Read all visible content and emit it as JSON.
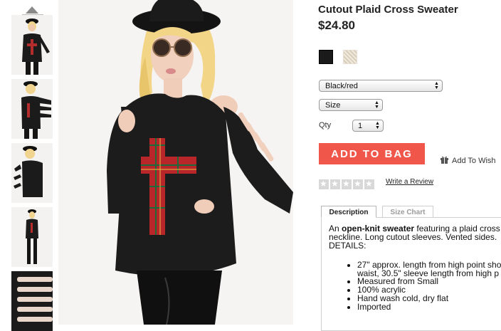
{
  "product": {
    "title": "Cutout Plaid Cross Sweater",
    "price": "$24.80"
  },
  "swatches": [
    {
      "name": "black",
      "color": "#1a1a1a"
    },
    {
      "name": "cream",
      "color": "#efe6d8"
    }
  ],
  "selects": {
    "color": {
      "value": "Black/red"
    },
    "size": {
      "value": "Size"
    },
    "qty_label": "Qty",
    "qty": {
      "value": "1"
    }
  },
  "actions": {
    "add_to_bag": "ADD TO BAG",
    "add_to_wishlist": "Add To Wish",
    "write_review": "Write a Review"
  },
  "rating": {
    "stars": 0,
    "max": 5
  },
  "tabs": [
    {
      "label": "Description",
      "active": true
    },
    {
      "label": "Size Chart",
      "active": false
    }
  ],
  "description": {
    "intro_prefix": "An ",
    "intro_bold": "open-knit sweater",
    "intro_rest": " featuring a plaid cross",
    "line2": "neckline. Long cutout sleeves. Vented sides.",
    "details_label": "DETAILS:",
    "bullets": [
      "27\" approx. length from high point sho",
      "waist, 30.5\" sleeve length from high p",
      "Measured from Small",
      "100% acrylic",
      "Hand wash cold, dry flat",
      "Imported"
    ]
  },
  "colors": {
    "accent": "#f0574a",
    "star_empty": "#d8d8d8"
  },
  "icons": {
    "scroll_up": "triangle-up-icon",
    "wishlist": "gift-icon",
    "select_arrows": "updown-arrows-icon"
  }
}
